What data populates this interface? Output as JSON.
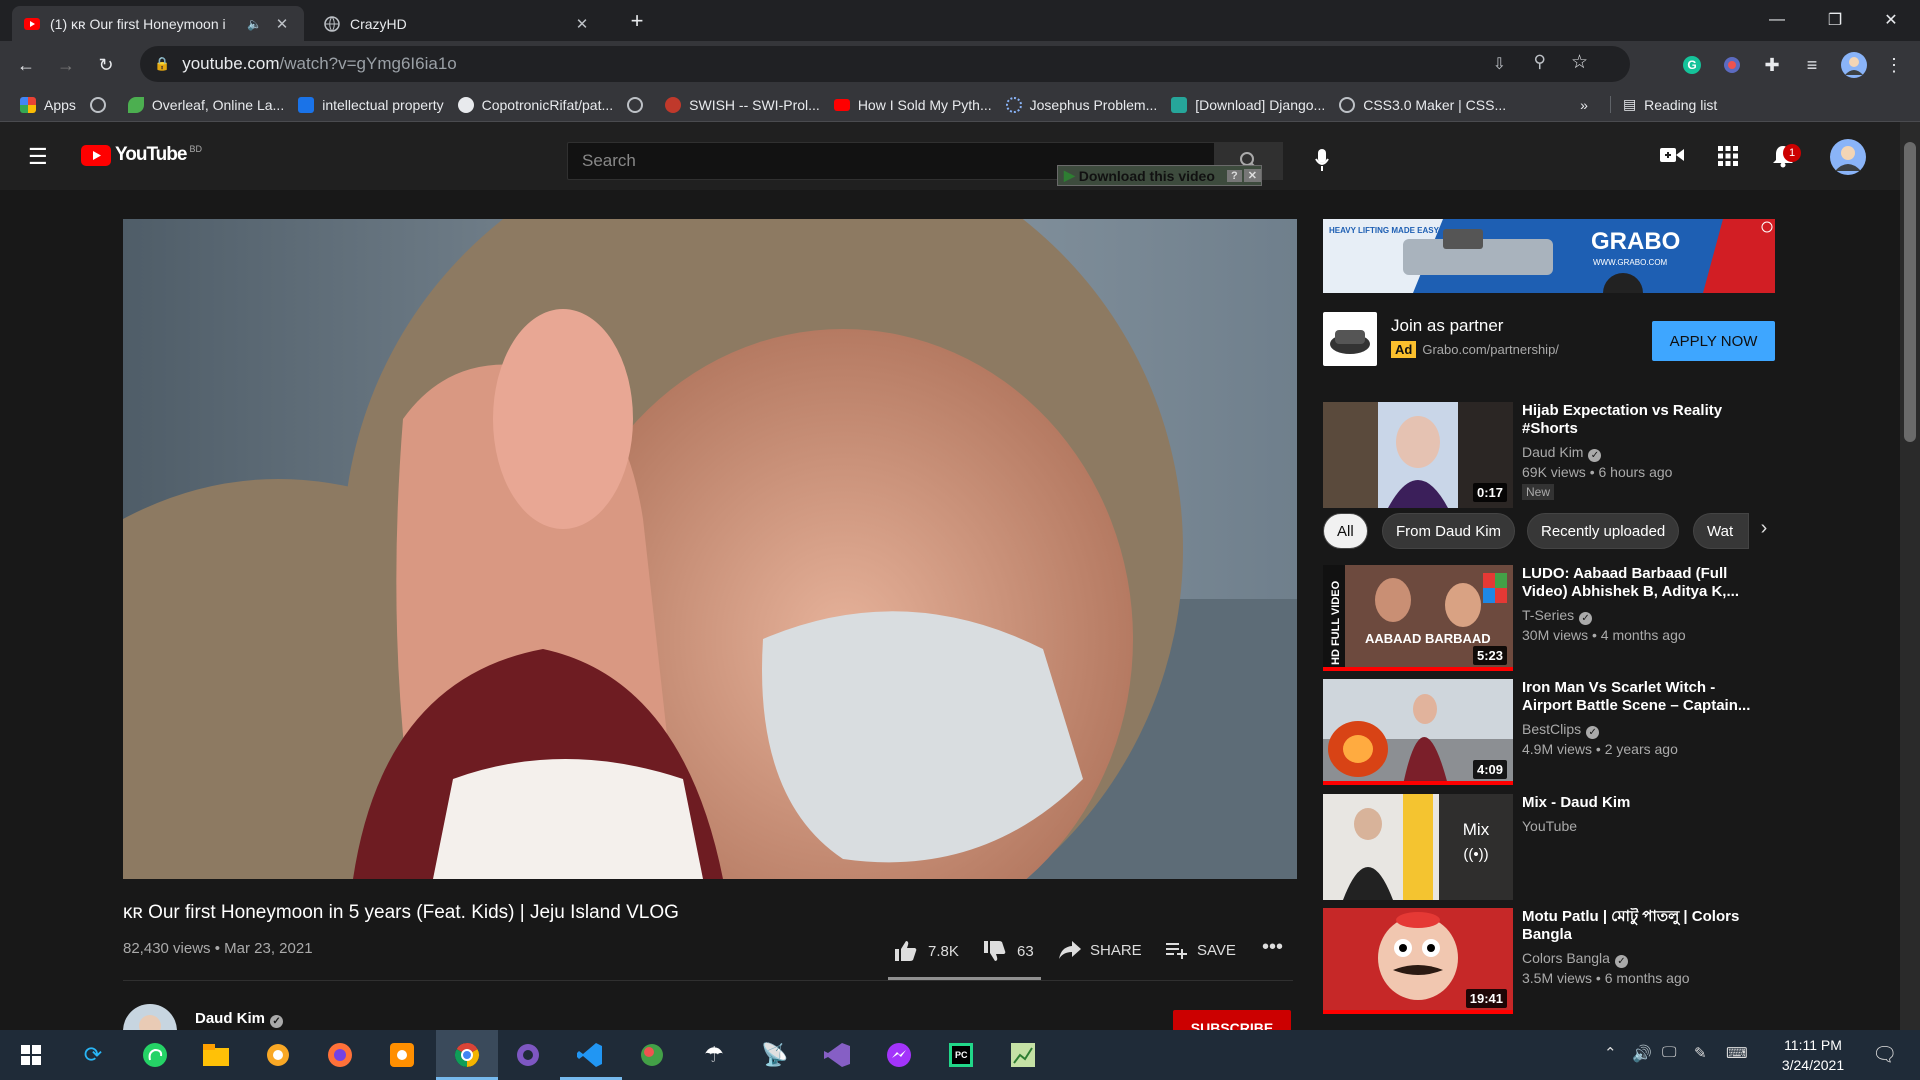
{
  "browser": {
    "tabs": [
      {
        "title": "(1) ᴋʀ Our first Honeymoon i",
        "active": true
      },
      {
        "title": "CrazyHD",
        "active": false
      }
    ],
    "new_tab_label": "+",
    "url_host": "youtube.com",
    "url_path": "/watch?v=gYmg6I6ia1o",
    "bookmarks": [
      {
        "label": "Apps",
        "color": "#e94235"
      },
      {
        "label": "",
        "color": "#bdc1c6"
      },
      {
        "label": "Overleaf, Online La...",
        "color": "#4caf50"
      },
      {
        "label": "intellectual property",
        "color": "#1a73e8"
      },
      {
        "label": "CopotronicRifat/pat...",
        "color": "#e8eaed"
      },
      {
        "label": "",
        "color": "#bdc1c6"
      },
      {
        "label": "SWISH -- SWI-Prol...",
        "color": "#c0392b"
      },
      {
        "label": "How I Sold My Pyth...",
        "color": "#ff0000"
      },
      {
        "label": "Josephus Problem...",
        "color": "#5f6368"
      },
      {
        "label": "[Download] Django...",
        "color": "#26a69a"
      },
      {
        "label": "CSS3.0 Maker | CSS...",
        "color": "#bdc1c6"
      }
    ],
    "bookmarks_more": "»",
    "reading_list": "Reading list"
  },
  "youtube": {
    "logo_text": "YouTube",
    "region": "BD",
    "search_placeholder": "Search",
    "download_overlay": "Download this video",
    "notification_count": "1",
    "video": {
      "title": "ᴋʀ Our first Honeymoon in 5 years (Feat. Kids) | Jeju Island VLOG",
      "views": "82,430 views",
      "date": "Mar 23, 2021",
      "likes": "7.8K",
      "dislikes": "63",
      "share_label": "SHARE",
      "save_label": "SAVE",
      "channel": "Daud Kim",
      "subscribe_label": "SUBSCRIBE"
    },
    "ad": {
      "banner_brand": "GRABO",
      "banner_tagline": "HEAVY LIFTING MADE EASY",
      "banner_url": "WWW.GRABO.COM",
      "title": "Join as partner",
      "badge": "Ad",
      "url": "Grabo.com/partnership/",
      "cta": "APPLY NOW"
    },
    "chips": [
      "All",
      "From Daud Kim",
      "Recently uploaded",
      "Wat"
    ],
    "recommendations": [
      {
        "title": "Hijab Expectation vs Reality #Shorts",
        "channel": "Daud Kim",
        "stats": "69K views • 6 hours ago",
        "badge": "New",
        "duration": "0:17",
        "verified": true
      },
      {
        "title": "LUDO: Aabaad Barbaad (Full Video) Abhishek B, Aditya K,...",
        "channel": "T-Series",
        "stats": "30M views • 4 months ago",
        "badge": "",
        "duration": "5:23",
        "verified": true
      },
      {
        "title": "Iron Man Vs Scarlet Witch - Airport Battle Scene – Captain...",
        "channel": "BestClips",
        "stats": "4.9M views • 2 years ago",
        "badge": "",
        "duration": "4:09",
        "verified": true
      },
      {
        "title": "Mix - Daud Kim",
        "channel": "YouTube",
        "stats": "",
        "badge": "",
        "duration": "",
        "verified": false
      },
      {
        "title": "Motu Patlu | মোটু পাতলু | Colors Bangla",
        "channel": "Colors Bangla",
        "stats": "3.5M views • 6 months ago",
        "badge": "",
        "duration": "19:41",
        "verified": true
      }
    ],
    "mix_label": "Mix",
    "thumb_texts": {
      "ludo_side": "HD FULL VIDEO",
      "ludo_song": "AABAAD BARBAAD"
    }
  },
  "taskbar": {
    "time": "11:11 PM",
    "date": "3/24/2021"
  }
}
